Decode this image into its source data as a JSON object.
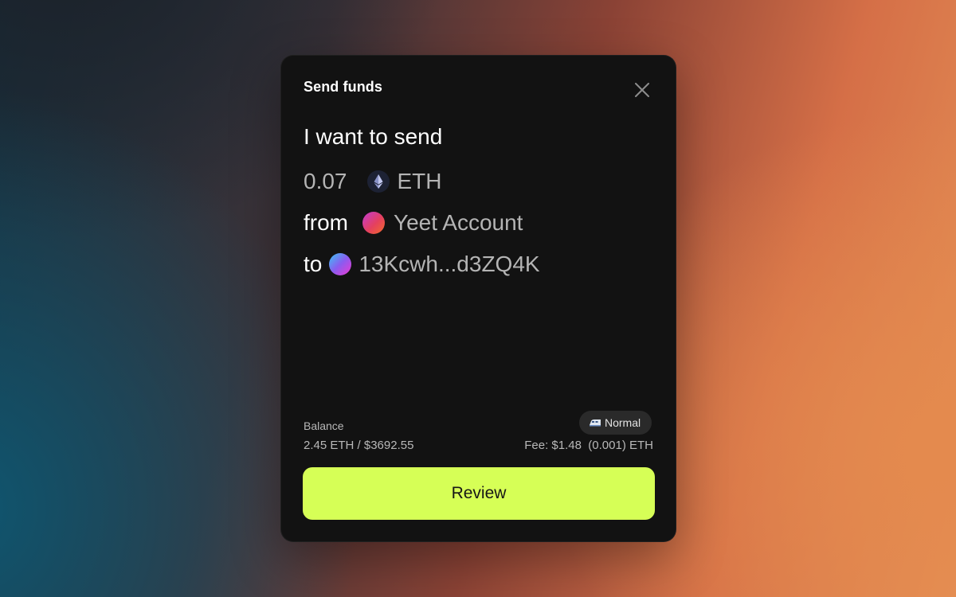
{
  "modal": {
    "title": "Send funds",
    "intro": "I want to send",
    "amount": "0.07",
    "asset": {
      "symbol": "ETH",
      "icon": "ethereum-icon"
    },
    "from": {
      "prefix": "from",
      "account_name": "Yeet Account",
      "icon": "account-avatar-gradient"
    },
    "to": {
      "prefix": "to",
      "address": "13Kcwh...d3ZQ4K",
      "icon": "recipient-avatar-gradient"
    },
    "balance": {
      "label": "Balance",
      "value": "2.45 ETH / $3692.55"
    },
    "fee_speed": {
      "label": "Normal",
      "icon": "speed-train-icon"
    },
    "fee": "Fee: $1.48  (0.001) ETH",
    "review_label": "Review"
  },
  "colors": {
    "modal_background": "#121212",
    "accent_button": "#d6ff56",
    "muted_text": "#b4b4b4"
  }
}
